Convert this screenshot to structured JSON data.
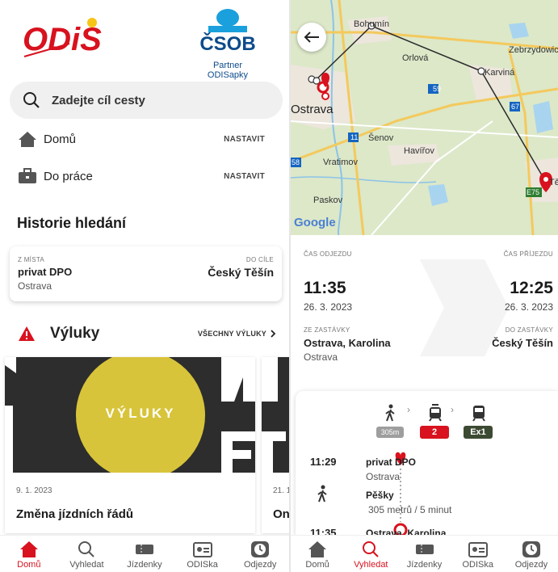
{
  "left": {
    "logo_brand": "ODiS",
    "partner_brand": "ČSOB",
    "partner_text": "Partner ODISapky",
    "search_placeholder": "Zadejte cíl cesty",
    "places": [
      {
        "label": "Domů",
        "action": "NASTAVIT",
        "icon": "house-icon"
      },
      {
        "label": "Do práce",
        "action": "NASTAVIT",
        "icon": "briefcase-icon"
      }
    ],
    "history_title": "Historie hledání",
    "history": {
      "from_label": "Z MÍSTA",
      "from_name": "privat DPO",
      "from_city": "Ostrava",
      "to_label": "DO CÍLE",
      "to_name": "Český Těšín"
    },
    "outages_title": "Výluky",
    "outages_all": "VŠECHNY VÝLUKY",
    "news": [
      {
        "image_text": "VÝLUKY",
        "date": "9. 1. 2023",
        "title": "Změna jízdních řádů"
      },
      {
        "date": "21. 1",
        "title": "On"
      }
    ],
    "nav": [
      {
        "label": "Domů",
        "icon": "home-icon",
        "active": true
      },
      {
        "label": "Vyhledat",
        "icon": "search-icon",
        "active": false
      },
      {
        "label": "Jízdenky",
        "icon": "ticket-icon",
        "active": false
      },
      {
        "label": "ODISka",
        "icon": "card-icon",
        "active": false
      },
      {
        "label": "Odjezdy",
        "icon": "clock-icon",
        "active": false
      }
    ]
  },
  "right": {
    "map": {
      "labels": [
        "Bohumín",
        "Orlová",
        "Karviná",
        "Zebrzydowic",
        "Ostrava",
        "Šenov",
        "Havířov",
        "Vratimov",
        "Paskov",
        "Těšín"
      ],
      "road_numbers": [
        "59",
        "11",
        "58",
        "67",
        "E75"
      ],
      "google": "Google"
    },
    "departure_label": "ČAS ODJEZDU",
    "departure_time": "11:35",
    "departure_date": "26. 3. 2023",
    "arrival_label": "ČAS PŘÍJEZDU",
    "arrival_time": "12:25",
    "arrival_date": "26. 3. 2023",
    "from_stop_label": "ZE ZASTÁVKY",
    "from_stop": "Ostrava, Karolina",
    "from_stop_city": "Ostrava",
    "to_stop_label": "DO ZASTÁVKY",
    "to_stop": "Český Těšín",
    "walk_distance": "305m",
    "tram_line": "2",
    "train_line": "Ex1",
    "steps": [
      {
        "time": "11:29",
        "name": "privat DPO",
        "sub": "Ostrava"
      },
      {
        "name": "Pěšky",
        "sub": "305 metrů / 5 minut"
      },
      {
        "time": "11:35",
        "name": "Ostrava, Karolina"
      }
    ],
    "nav": [
      {
        "label": "Domů",
        "icon": "home-icon",
        "active": false
      },
      {
        "label": "Vyhledat",
        "icon": "search-icon",
        "active": true
      },
      {
        "label": "Jízdenky",
        "icon": "ticket-icon",
        "active": false
      },
      {
        "label": "ODISka",
        "icon": "card-icon",
        "active": false
      },
      {
        "label": "Odjezdy",
        "icon": "clock-icon",
        "active": false
      }
    ]
  },
  "colors": {
    "accent": "#d8121e",
    "csob_blue": "#0d4b8a",
    "csob_light": "#1aa0dc"
  }
}
